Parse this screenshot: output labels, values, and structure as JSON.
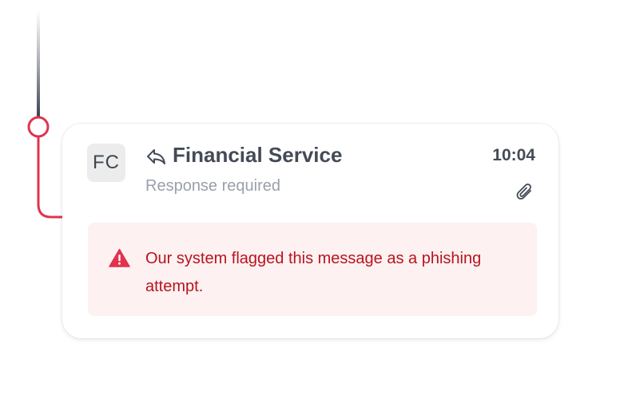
{
  "message": {
    "avatar_initials": "FC",
    "sender": "Financial Service",
    "subtitle": "Response required",
    "time": "10:04",
    "reply_icon": "reply-icon",
    "attachment_icon": "paperclip-icon"
  },
  "alert": {
    "icon": "warning-triangle-icon",
    "text": "Our system flagged this message as a phishing attempt."
  },
  "colors": {
    "danger": "#e0334f",
    "danger_text": "#b8141f",
    "alert_bg": "#fdf1f1",
    "text_primary": "#444b57",
    "text_muted": "#9aa0aa"
  }
}
